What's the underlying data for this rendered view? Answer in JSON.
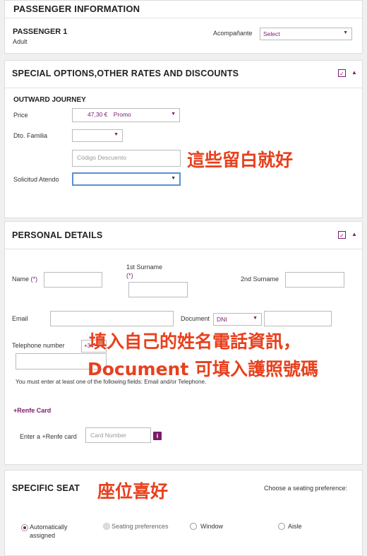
{
  "passenger_info": {
    "title": "PASSENGER INFORMATION",
    "passenger_label": "PASSENGER 1",
    "passenger_type": "Adult",
    "companion_label": "Acompañante",
    "companion_value": "Select"
  },
  "special_options": {
    "title": "SPECIAL OPTIONS,OTHER RATES AND DISCOUNTS",
    "journey_title": "OUTWARD JOURNEY",
    "price_label": "Price",
    "price_value": "47,30 €",
    "price_rate": "Promo",
    "family_label": "Dto. Familia",
    "family_value": "",
    "discount_placeholder": "Código Descuento",
    "solicitud_label": "Solicitud Atendo",
    "solicitud_value": ""
  },
  "personal_details": {
    "title": "PERSONAL DETAILS",
    "name_label": "Name",
    "required_mark": "(*)",
    "surname1_label": "1st Surname",
    "surname2_label": "2nd Surname",
    "email_label": "Email",
    "document_label": "Document",
    "document_type": "DNI",
    "telephone_label": "Telephone number",
    "phone_prefix": "+34",
    "notice": "You must enter at least one of the following fields: Email and/or Telephone.",
    "renfe_card_title": "+Renfe Card",
    "renfe_card_label": "Enter a +Renfe card",
    "card_placeholder": "Card Number",
    "info_icon_text": "i"
  },
  "specific_seat": {
    "title": "SPECIFIC SEAT",
    "choose_label": "Choose a seating preference:",
    "options": [
      {
        "label": "Automatically assigned",
        "selected": true
      },
      {
        "label": "Seating preferences",
        "selected": false,
        "disabled": true
      },
      {
        "label": "Window",
        "selected": false
      },
      {
        "label": "Aisle",
        "selected": false
      }
    ]
  },
  "annotations": {
    "blank_note": "這些留白就好",
    "fill_note_line1": "填入自己的姓名電話資訊，",
    "fill_note_line2": "Document 可填入護照號碼",
    "seat_note": "座位喜好"
  },
  "colors": {
    "accent": "#7a1a6a",
    "annotation": "#e8401d",
    "focus_border": "#5b8fd6"
  }
}
